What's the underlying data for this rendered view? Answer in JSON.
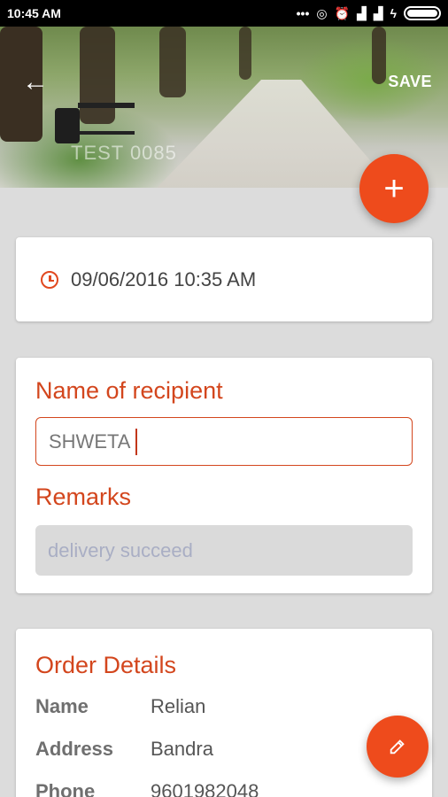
{
  "status_bar": {
    "time": "10:45 AM"
  },
  "header": {
    "title": "TEST 0085",
    "save_label": "SAVE"
  },
  "datetime": "09/06/2016 10:35 AM",
  "form": {
    "recipient_label": "Name of recipient",
    "recipient_value": "SHWETA",
    "remarks_label": "Remarks",
    "remarks_placeholder": "delivery succeed"
  },
  "order": {
    "title": "Order Details",
    "rows": [
      {
        "key": "Name",
        "value": "Relian"
      },
      {
        "key": "Address",
        "value": "Bandra"
      },
      {
        "key": "Phone",
        "value": "9601982048"
      }
    ]
  },
  "colors": {
    "accent": "#ee4b1c",
    "label": "#d3461d"
  },
  "icons": [
    "back-arrow-icon",
    "add-icon",
    "clock-icon",
    "edit-pencil-icon"
  ]
}
